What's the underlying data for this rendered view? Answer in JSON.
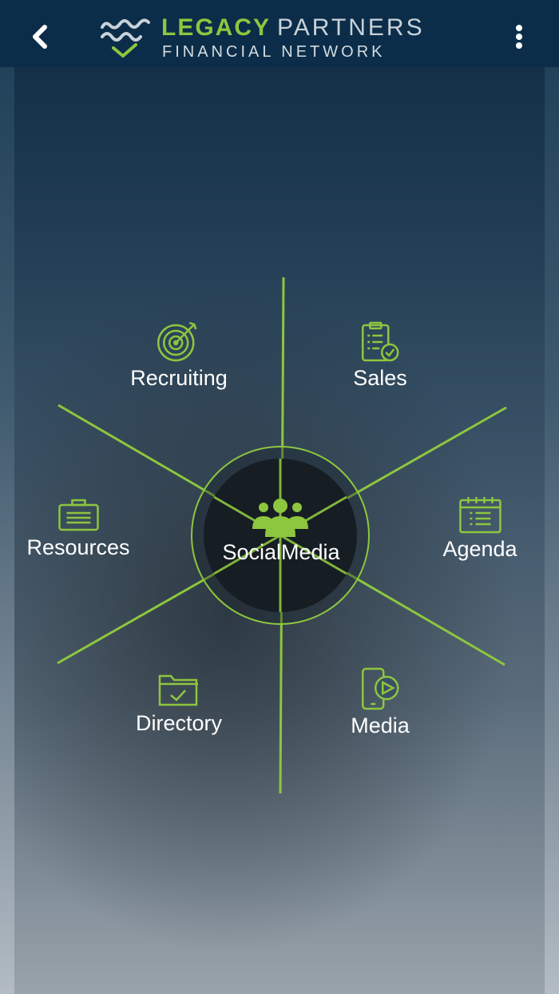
{
  "header": {
    "logo_word1": "LEGACY",
    "logo_word2": "PARTNERS",
    "logo_tagline": "FINANCIAL NETWORK"
  },
  "wheel": {
    "center": {
      "label": "SocialMedia",
      "icon": "group-icon"
    },
    "items": [
      {
        "label": "Recruiting",
        "icon": "target-icon"
      },
      {
        "label": "Sales",
        "icon": "clipboard-check-icon"
      },
      {
        "label": "Resources",
        "icon": "briefcase-icon"
      },
      {
        "label": "Agenda",
        "icon": "calendar-icon"
      },
      {
        "label": "Directory",
        "icon": "folder-check-icon"
      },
      {
        "label": "Media",
        "icon": "phone-play-icon"
      }
    ]
  },
  "colors": {
    "accent": "#8dc63f",
    "header_bg": "#0b2d49",
    "text": "#ffffff"
  }
}
